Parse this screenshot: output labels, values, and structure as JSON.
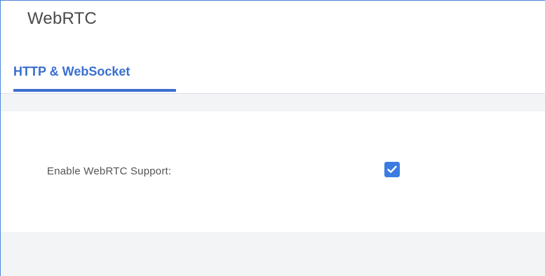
{
  "page": {
    "title": "WebRTC"
  },
  "tabs": [
    {
      "label": "HTTP & WebSocket",
      "active": true
    }
  ],
  "settings": {
    "enable_webrtc": {
      "label": "Enable WebRTC Support:",
      "checked": true
    }
  },
  "colors": {
    "accent": "#3a6fd0",
    "checkbox": "#3b7ce0",
    "band": "#f3f4f6",
    "frame_border": "#4d86d8"
  },
  "icons": {
    "checkbox": "check-icon"
  }
}
